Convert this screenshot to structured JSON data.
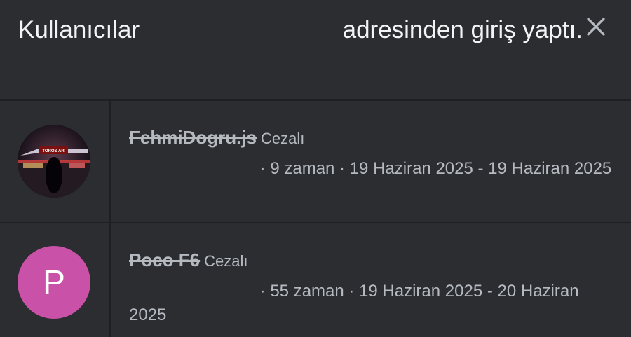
{
  "header": {
    "title_prefix": "Kullanıcılar",
    "title_suffix": "adresinden giriş yaptı."
  },
  "colors": {
    "background": "#2b2d31",
    "divider": "#1e1f22",
    "text_primary": "#f2f3f5",
    "text_secondary": "#b5bac1",
    "avatar_letter_bg": "#c951a7"
  },
  "users": [
    {
      "name": "FehmiDogru.js",
      "status": "Cezalı",
      "meta": "· 9 zaman · 19 Haziran 2025 - 19 Haziran 2025",
      "avatar_type": "photo",
      "avatar_sign_text": "TOROS AR"
    },
    {
      "name": "Poco F6",
      "status": "Cezalı",
      "meta": "· 55 zaman · 19 Haziran 2025 - 20 Haziran 2025",
      "avatar_type": "letter",
      "avatar_letter": "P"
    }
  ]
}
